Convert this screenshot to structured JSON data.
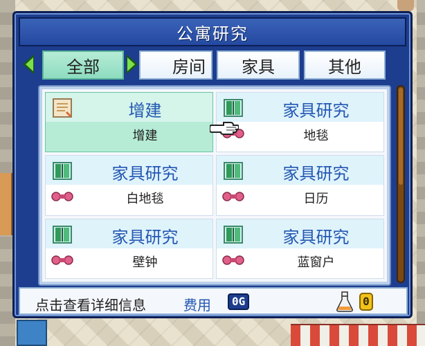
{
  "dialog": {
    "title": "公寓研究"
  },
  "tabs": [
    {
      "label": "全部",
      "active": true
    },
    {
      "label": "房间",
      "active": false
    },
    {
      "label": "家具",
      "active": false
    },
    {
      "label": "其他",
      "active": false
    }
  ],
  "items": [
    {
      "title": "增建",
      "name": "增建",
      "icon": "memo-scroll-icon",
      "category_icon": null,
      "selected": true
    },
    {
      "title": "家具研究",
      "name": "地毯",
      "icon": "research-book-icon",
      "category_icon": "ribbon-icon",
      "selected": false
    },
    {
      "title": "家具研究",
      "name": "白地毯",
      "icon": "research-book-icon",
      "category_icon": "ribbon-icon",
      "selected": false
    },
    {
      "title": "家具研究",
      "name": "日历",
      "icon": "research-book-icon",
      "category_icon": "ribbon-icon",
      "selected": false
    },
    {
      "title": "家具研究",
      "name": "壁钟",
      "icon": "research-book-icon",
      "category_icon": "ribbon-icon",
      "selected": false
    },
    {
      "title": "家具研究",
      "name": "蓝窗户",
      "icon": "research-book-icon",
      "category_icon": "ribbon-icon",
      "selected": false
    }
  ],
  "footer": {
    "hint": "点击查看详细信息",
    "cost_label": "费用",
    "cost_value": "0G",
    "research_points": "0"
  },
  "colors": {
    "dialog_bg": "#1d3d8e",
    "selected_cell": "#b6ecd6",
    "title_text": "#2357b3",
    "ribbon": "#e0608a",
    "points_badge": "#f0c21a"
  }
}
